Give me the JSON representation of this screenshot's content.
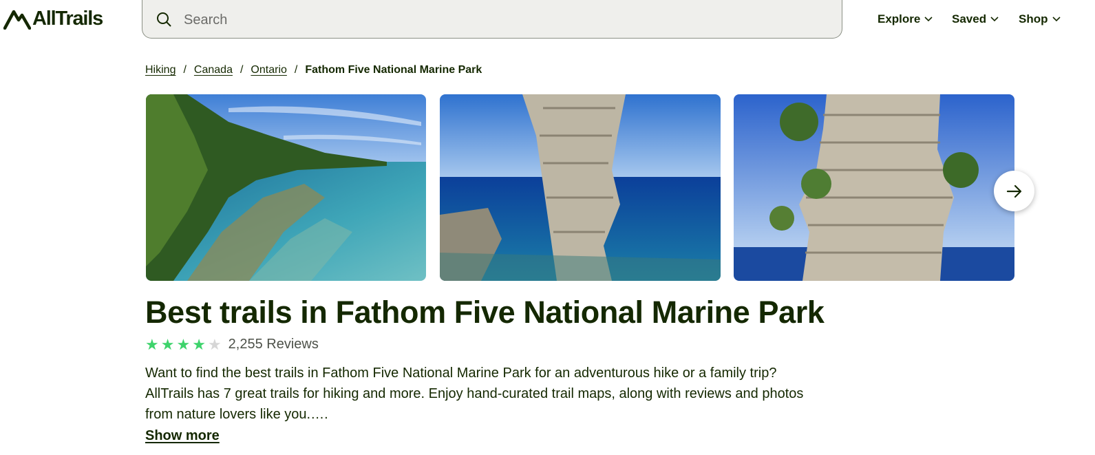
{
  "header": {
    "logo_text": "AllTrails",
    "search": {
      "placeholder": "Search",
      "value": ""
    },
    "nav": [
      {
        "label": "Explore"
      },
      {
        "label": "Saved"
      },
      {
        "label": "Shop"
      }
    ]
  },
  "breadcrumb": {
    "items": [
      "Hiking",
      "Canada",
      "Ontario"
    ],
    "separator": "/",
    "current": "Fathom Five National Marine Park"
  },
  "gallery": {
    "photos": [
      {
        "label": "lakeshore-photo"
      },
      {
        "label": "flowerpot-rock-photo"
      },
      {
        "label": "flowerpot-rock-closeup-photo"
      }
    ],
    "next_icon": "arrow-right-icon"
  },
  "main": {
    "title": "Best trails in Fathom Five National Marine Park",
    "rating": 4,
    "rating_max": 5,
    "reviews_label": "2,255 Reviews",
    "description": "Want to find the best trails in Fathom Five National Marine Park for an adventurous hike or a family trip? AllTrails has 7 great trails for hiking and more. Enjoy hand-curated trail maps, along with reviews and photos from nature lovers like you.….",
    "show_more_label": "Show more"
  },
  "colors": {
    "brand": "#142800",
    "star": "#3ed36c",
    "search_bg": "#efefec"
  }
}
